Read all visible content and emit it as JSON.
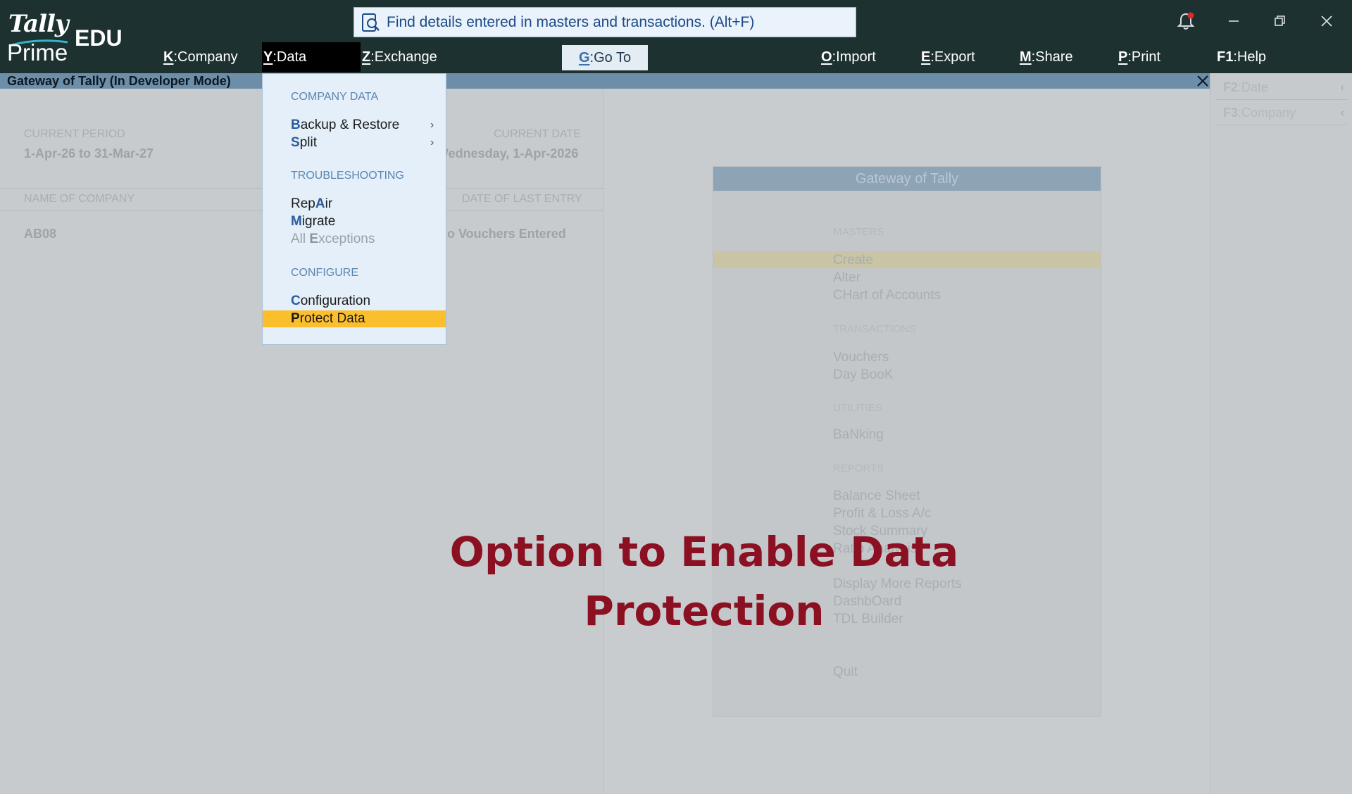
{
  "app": {
    "logo_line1": "Tally",
    "logo_line2": "Prime",
    "edition": "EDU"
  },
  "search": {
    "text": "Find details entered in masters and transactions. (Alt+F)"
  },
  "menubar": [
    {
      "key": "K",
      "label": "Company"
    },
    {
      "key": "Y",
      "label": "Data",
      "active": true
    },
    {
      "key": "Z",
      "label": "Exchange"
    },
    {
      "key": "G",
      "label": "Go To"
    },
    {
      "key": "O",
      "label": "Import"
    },
    {
      "key": "E",
      "label": "Export"
    },
    {
      "key": "M",
      "label": "Share"
    },
    {
      "key": "P",
      "label": "Print"
    },
    {
      "key": "F1",
      "label": "Help"
    }
  ],
  "window": {
    "title": "Gateway of Tally (In Developer Mode)"
  },
  "right_panel": [
    {
      "key": "F2",
      "label": "Date"
    },
    {
      "key": "F3",
      "label": "Company"
    }
  ],
  "company_info": {
    "current_period_label": "CURRENT PERIOD",
    "current_period_value": "1-Apr-26 to 31-Mar-27",
    "current_date_label": "CURRENT DATE",
    "current_date_value": "Wednesday, 1-Apr-2026",
    "name_label": "NAME OF COMPANY",
    "last_entry_label": "DATE OF LAST ENTRY",
    "company_name": "AB08",
    "last_entry_value": "No Vouchers Entered"
  },
  "gateway": {
    "title": "Gateway of Tally",
    "sections": {
      "masters": "MASTERS",
      "transactions": "TRANSACTIONS",
      "utilities": "UTILITIES",
      "reports": "REPORTS"
    },
    "items": {
      "create": "Create",
      "alter": "Alter",
      "chart": "CHart of Accounts",
      "vouchers": "Vouchers",
      "daybook": "Day BooK",
      "banking": "BaNking",
      "balance_sheet": "Balance Sheet",
      "pl": "Profit & Loss A/c",
      "stock": "Stock Summary",
      "ratio": "Ratio Analysis",
      "more_reports": "Display More Reports",
      "dashboard": "DashbOard",
      "tdl": "TDL Builder",
      "quit": "Quit"
    }
  },
  "dropdown": {
    "sections": {
      "company_data": "COMPANY DATA",
      "troubleshooting": "TROUBLESHOOTING",
      "configure": "CONFIGURE"
    },
    "items": {
      "backup_pre": "",
      "backup_hk": "B",
      "backup_post": "ackup & Restore",
      "split_pre": "",
      "split_hk": "S",
      "split_post": "plit",
      "repair_pre": "Rep",
      "repair_hk": "A",
      "repair_post": "ir",
      "migrate_pre": "",
      "migrate_hk": "M",
      "migrate_post": "igrate",
      "exceptions_pre": "All ",
      "exceptions_hk": "E",
      "exceptions_post": "xceptions",
      "config_pre": "",
      "config_hk": "C",
      "config_post": "onfiguration",
      "protect_pre": "",
      "protect_hk": "P",
      "protect_post": "rotect Data"
    }
  },
  "caption": {
    "line1": "Option to Enable Data",
    "line2": "Protection"
  },
  "colors": {
    "topbar": "#1d3131",
    "highlight": "#fbbf2e",
    "caption": "#8a1022"
  }
}
